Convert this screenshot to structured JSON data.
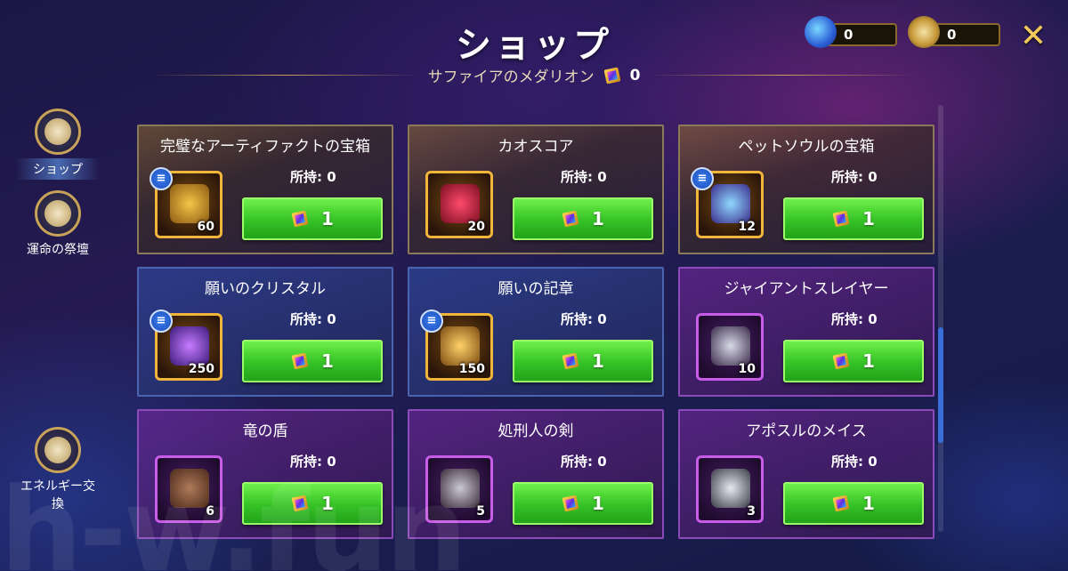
{
  "header": {
    "title": "ショップ",
    "subtitle": "サファイアのメダリオン",
    "subtitle_count": "0"
  },
  "currencies": [
    {
      "icon": "energy-gem-icon",
      "value": "0"
    },
    {
      "icon": "medal-icon",
      "value": "0"
    }
  ],
  "close_icon": "✕",
  "sidebar": {
    "items": [
      {
        "label": "ショップ",
        "icon": "shop-icon",
        "active": true
      },
      {
        "label": "運命の祭壇",
        "icon": "altar-star-icon",
        "active": false
      },
      {
        "label": "エネルギー交換",
        "icon": "energy-exchange-icon",
        "active": false
      }
    ]
  },
  "owned_label": "所持: 0",
  "items": [
    {
      "title": "完璧なアーティファクトの宝箱",
      "qty": "60",
      "price": "1",
      "rarity": "gold",
      "info": true,
      "art": "artifact-chest"
    },
    {
      "title": "カオスコア",
      "qty": "20",
      "price": "1",
      "rarity": "gold",
      "info": false,
      "art": "chaos-core"
    },
    {
      "title": "ペットソウルの宝箱",
      "qty": "12",
      "price": "1",
      "rarity": "gold",
      "info": true,
      "art": "pet-soul-chest"
    },
    {
      "title": "願いのクリスタル",
      "qty": "250",
      "price": "1",
      "rarity": "blue",
      "info": true,
      "art": "wish-crystal"
    },
    {
      "title": "願いの記章",
      "qty": "150",
      "price": "1",
      "rarity": "blue",
      "info": true,
      "art": "wish-emblem"
    },
    {
      "title": "ジャイアントスレイヤー",
      "qty": "10",
      "price": "1",
      "rarity": "purple",
      "info": false,
      "art": "giant-slayer-bow"
    },
    {
      "title": "竜の盾",
      "qty": "6",
      "price": "1",
      "rarity": "purple",
      "info": false,
      "art": "dragon-shield"
    },
    {
      "title": "処刑人の剣",
      "qty": "5",
      "price": "1",
      "rarity": "purple",
      "info": false,
      "art": "executioner-sword"
    },
    {
      "title": "アポスルのメイス",
      "qty": "3",
      "price": "1",
      "rarity": "purple",
      "info": false,
      "art": "apostle-mace"
    }
  ],
  "watermark": "h-w.fun"
}
